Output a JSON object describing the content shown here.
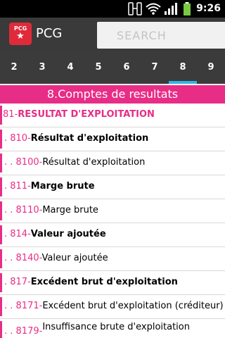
{
  "status_bar": {
    "time": "9:26"
  },
  "app": {
    "title": "PCG",
    "logo_text": "PCG"
  },
  "search": {
    "placeholder": "SEARCH"
  },
  "tabs": [
    {
      "label": "2"
    },
    {
      "label": "3"
    },
    {
      "label": "4"
    },
    {
      "label": "5"
    },
    {
      "label": "6"
    },
    {
      "label": "7"
    },
    {
      "label": "8"
    },
    {
      "label": "9"
    }
  ],
  "active_tab": "8",
  "section": {
    "title": "8.Comptes de resultats"
  },
  "rows": [
    {
      "prefix": "",
      "code": "81-",
      "title": "RESULTAT D'EXPLOITATION"
    },
    {
      "prefix": ". ",
      "code": "810-",
      "title": "Résultat d'exploitation"
    },
    {
      "prefix": ". . ",
      "code": "8100-",
      "title": "Résultat d'exploitation"
    },
    {
      "prefix": ". ",
      "code": "811-",
      "title": "Marge brute"
    },
    {
      "prefix": ". . ",
      "code": "8110-",
      "title": "Marge brute"
    },
    {
      "prefix": ". ",
      "code": "814-",
      "title": "Valeur ajoutée"
    },
    {
      "prefix": ". . ",
      "code": "8140-",
      "title": "Valeur ajoutée"
    },
    {
      "prefix": ". ",
      "code": "817-",
      "title": "Excédent brut d'exploitation"
    },
    {
      "prefix": ". . ",
      "code": "8171-",
      "title": "Excédent brut d'exploitation (créditeur)"
    },
    {
      "prefix": ". . ",
      "code": "8179-",
      "title": "Insuffisance brute d'exploitation"
    }
  ],
  "colors": {
    "accent": "#e82d86",
    "tab_indicator": "#33b5e5",
    "action_bar": "#3a3a3a",
    "logo": "#e02a3a"
  },
  "icons": [
    "nfc-icon",
    "wifi-icon",
    "signal-icon",
    "battery-icon",
    "star-icon"
  ]
}
